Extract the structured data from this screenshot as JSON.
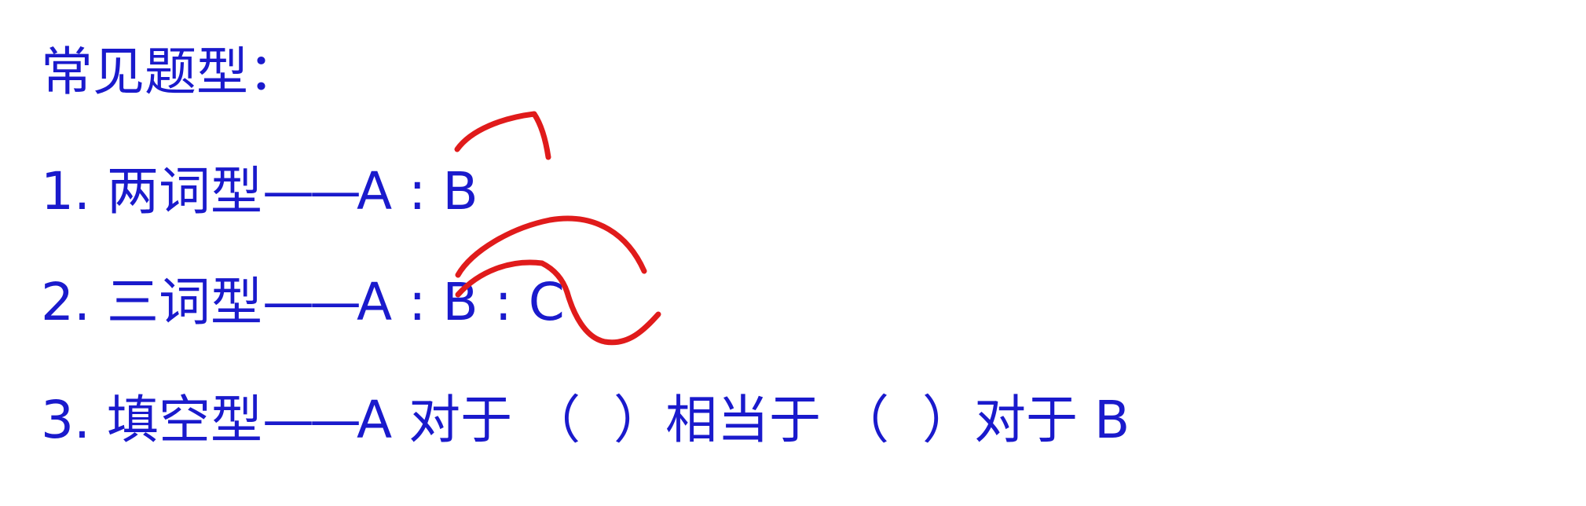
{
  "heading": "常见题型：",
  "items": [
    {
      "number": "1.",
      "name": "两词型",
      "dash": "——",
      "formula": "A : B"
    },
    {
      "number": "2.",
      "name": "三词型",
      "dash": "——",
      "formula": "A : B : C"
    },
    {
      "number": "3.",
      "name": "填空型",
      "dash": "——",
      "formula": "A 对于 （  ）相当于 （  ）对于 B"
    }
  ],
  "colors": {
    "text": "#1a1acc",
    "ink_annotation": "#e01b1b",
    "background": "#ffffff"
  }
}
